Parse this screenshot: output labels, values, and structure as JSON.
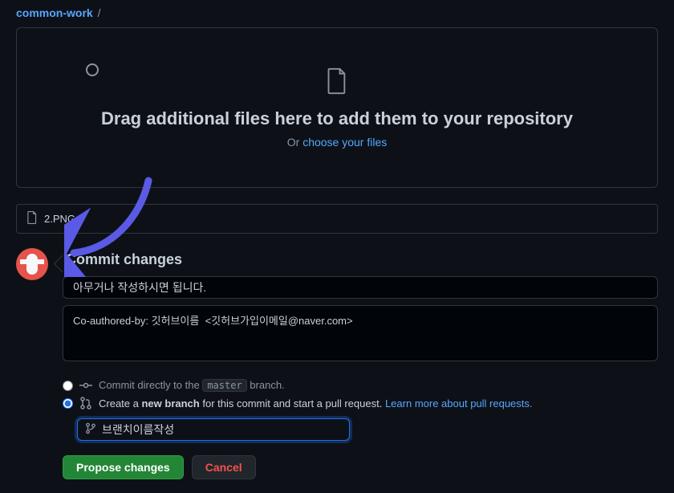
{
  "breadcrumb": {
    "repo": "common-work",
    "sep": "/"
  },
  "dropzone": {
    "heading": "Drag additional files here to add them to your repository",
    "or_prefix": "Or ",
    "choose_link": "choose your files"
  },
  "uploaded_file": {
    "name": "2.PNG"
  },
  "commit": {
    "heading": "Commit changes",
    "summary_value": "아무거나 작성하시면 됩니다.",
    "description_value": "Co-authored-by: 깃허브이름  <깃허브가입이메일@naver.com>"
  },
  "branch_options": {
    "direct_prefix": "Commit directly to the ",
    "direct_branch": "master",
    "direct_suffix": " branch.",
    "new_prefix": "Create a ",
    "new_strong": "new branch",
    "new_suffix": " for this commit and start a pull request. ",
    "learn_more": "Learn more about pull requests.",
    "branch_name_value": "브랜치이름작성"
  },
  "actions": {
    "propose": "Propose changes",
    "cancel": "Cancel"
  }
}
